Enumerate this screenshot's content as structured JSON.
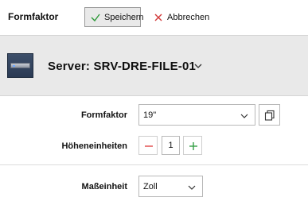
{
  "toolbar": {
    "title": "Formfaktor",
    "save_label": "Speichern",
    "cancel_label": "Abbrechen"
  },
  "header": {
    "server_title": "Server: SRV-DRE-FILE-01"
  },
  "form": {
    "formfaktor": {
      "label": "Formfaktor",
      "value": "19\""
    },
    "hoeheneinheiten": {
      "label": "Höheneinheiten",
      "value": "1"
    },
    "masseinheit": {
      "label": "Maßeinheit",
      "value": "Zoll"
    }
  },
  "icons": {
    "save": "check-icon",
    "cancel": "x-icon",
    "server": "server-rack-icon",
    "copy": "copy-icon",
    "minus": "minus-icon",
    "plus": "plus-icon",
    "chevron": "chevron-down-icon"
  },
  "colors": {
    "save_check": "#2e9a3a",
    "cancel_x": "#d23a3a",
    "minus": "#e04848",
    "plus": "#35a046",
    "header_bg": "#e9e9e9"
  }
}
